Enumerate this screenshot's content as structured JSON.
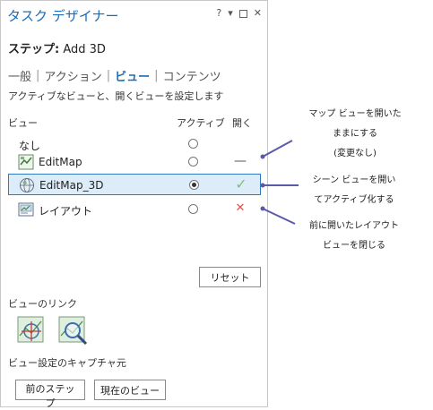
{
  "pane": {
    "title": "タスク デザイナー",
    "help": "?",
    "menu": "▾",
    "close": "✕"
  },
  "step": {
    "label": "ステップ:",
    "name": "Add 3D"
  },
  "tabs": [
    {
      "label": "一般",
      "active": false
    },
    {
      "label": "アクション",
      "active": false
    },
    {
      "label": "ビュー",
      "active": true
    },
    {
      "label": "コンテンツ",
      "active": false
    }
  ],
  "description": "アクティブなビューと、開くビューを設定します",
  "columns": {
    "view": "ビュー",
    "active": "アクティブ",
    "open": "開く"
  },
  "rows": [
    {
      "label": "なし",
      "icon": "none",
      "active": false,
      "status": ""
    },
    {
      "label": "EditMap",
      "icon": "map-icon",
      "active": false,
      "status": "—",
      "status_color": "#555555"
    },
    {
      "label": "EditMap_3D",
      "icon": "globe-icon",
      "active": true,
      "status": "✓",
      "status_color": "#7fbf7f"
    },
    {
      "label": "レイアウト",
      "icon": "layout-icon",
      "active": false,
      "status": "✕",
      "status_color": "#d9534f"
    }
  ],
  "buttons": {
    "reset": "リセット",
    "prev_step": "前のステップ",
    "current_view": "現在のビュー"
  },
  "sections": {
    "view_link": "ビューのリンク",
    "capture_from": "ビュー設定のキャプチャ元"
  },
  "annotations": {
    "keep_open": [
      "マップ ビューを開いた",
      "ままにする",
      "(変更なし)"
    ],
    "open_activate": [
      "シーン ビューを開い",
      "てアクティブ化する"
    ],
    "close_layout": [
      "前に開いたレイアウト",
      "ビューを閉じる"
    ]
  },
  "colors": {
    "accent": "#1a6cb8",
    "callout": "#5a5aa8",
    "selected_bg": "#dcecf8"
  }
}
